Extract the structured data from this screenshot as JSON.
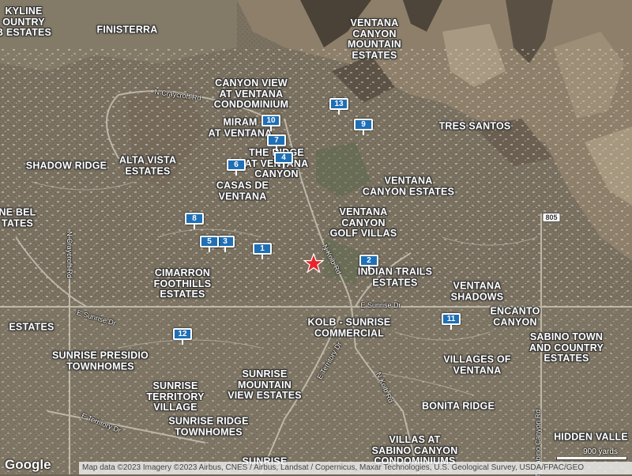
{
  "map": {
    "labels": [
      {
        "text": "KYLINE\nOUNTRY\nB ESTATES",
        "name": "skyline-country-club-estates-label"
      },
      {
        "text": "FINISTERRA",
        "name": "finisterra-label"
      },
      {
        "text": "VENTANA\nCANYON\nMOUNTAIN\nESTATES",
        "name": "ventana-canyon-mountain-estates-label"
      },
      {
        "text": "CANYON VIEW\nAT VENTANA\nCONDOMINIUM",
        "name": "canyon-view-label"
      },
      {
        "text": "MIRAM\nAT VENTANA",
        "name": "miramonte-label"
      },
      {
        "text": "TRES SANTOS",
        "name": "tres-santos-label"
      },
      {
        "text": "THE RIDGE\nAT VENTANA\nCANYON",
        "name": "the-ridge-label"
      },
      {
        "text": "SHADOW RIDGE",
        "name": "shadow-ridge-label"
      },
      {
        "text": "ALTA VISTA\nESTATES",
        "name": "alta-vista-estates-label"
      },
      {
        "text": "CASAS DE\nVENTANA",
        "name": "casas-de-ventana-label"
      },
      {
        "text": "VENTANA\nCANYON ESTATES",
        "name": "ventana-canyon-estates-label"
      },
      {
        "text": "NE BEL\nTATES",
        "name": "bel-estates-label"
      },
      {
        "text": "VENTANA\nCANYON\nGOLF VILLAS",
        "name": "ventana-canyon-golf-villas-label"
      },
      {
        "text": "CIMARRON\nFOOTHILLS\nESTATES",
        "name": "cimarron-foothills-estates-label"
      },
      {
        "text": "INDIAN TRAILS\nESTATES",
        "name": "indian-trails-estates-label"
      },
      {
        "text": "VENTANA\nSHADOWS",
        "name": "ventana-shadows-label"
      },
      {
        "text": "ENCANTO\nCANYON",
        "name": "encanto-canyon-label"
      },
      {
        "text": "ESTATES",
        "name": "estates-left-label"
      },
      {
        "text": "KOLB - SUNRISE\nCOMMERCIAL",
        "name": "kolb-sunrise-commercial-label"
      },
      {
        "text": "SABINO TOWN\nAND COUNTRY\nESTATES",
        "name": "sabino-town-and-country-label"
      },
      {
        "text": "SUNRISE PRESIDIO\nTOWNHOMES",
        "name": "sunrise-presidio-townhomes-label"
      },
      {
        "text": "VILLAGES OF\nVENTANA",
        "name": "villages-of-ventana-label"
      },
      {
        "text": "SUNRISE\nMOUNTAIN\nVIEW ESTATES",
        "name": "sunrise-mountain-view-estates-label"
      },
      {
        "text": "SUNRISE\nTERRITORY\nVILLAGE",
        "name": "sunrise-territory-village-label"
      },
      {
        "text": "BONITA RIDGE",
        "name": "bonita-ridge-label"
      },
      {
        "text": "SUNRISE RIDGE\nTOWNHOMES",
        "name": "sunrise-ridge-townhomes-label"
      },
      {
        "text": "HIDDEN VALLE",
        "name": "hidden-valley-label"
      },
      {
        "text": "VILLAS AT\nSABINO CANYON\nCONDOMINIUMS",
        "name": "villas-at-sabino-canyon-label"
      },
      {
        "text": "SUNRISE",
        "name": "sunrise-bottom-label"
      }
    ],
    "roads": [
      {
        "text": "N Craycroft Rd",
        "name": "craycroft-road-label-top"
      },
      {
        "text": "N Craycroft Rd",
        "name": "craycroft-road-label-left"
      },
      {
        "text": "E Sunrise Dr",
        "name": "sunrise-drive-label-left"
      },
      {
        "text": "E Sunrise Dr",
        "name": "sunrise-drive-label-right"
      },
      {
        "text": "N Kolb Rd",
        "name": "kolb-road-label-north"
      },
      {
        "text": "N Kolb Rd",
        "name": "kolb-road-label-south"
      },
      {
        "text": "E Territory Dr",
        "name": "territory-drive-label-center"
      },
      {
        "text": "E Territory Dr",
        "name": "territory-drive-label-left"
      },
      {
        "text": "N Sabino Canyon Rd",
        "name": "sabino-canyon-road-label"
      }
    ],
    "highway_shield": "805",
    "markers": [
      "1",
      "2",
      "3",
      "4",
      "5",
      "6",
      "7",
      "8",
      "9",
      "10",
      "11",
      "12",
      "13"
    ],
    "marker_color": "#1f6fb5",
    "star_color": "#e8252a",
    "star_icon": "red-star-icon"
  },
  "footer": {
    "logo": "Google",
    "attribution": "Map data ©2023 Imagery ©2023 Airbus, CNES / Airbus, Landsat / Copernicus, Maxar Technologies, U.S. Geological Survey, USDA/FPAC/GEO",
    "scale_label": "900 yards"
  }
}
